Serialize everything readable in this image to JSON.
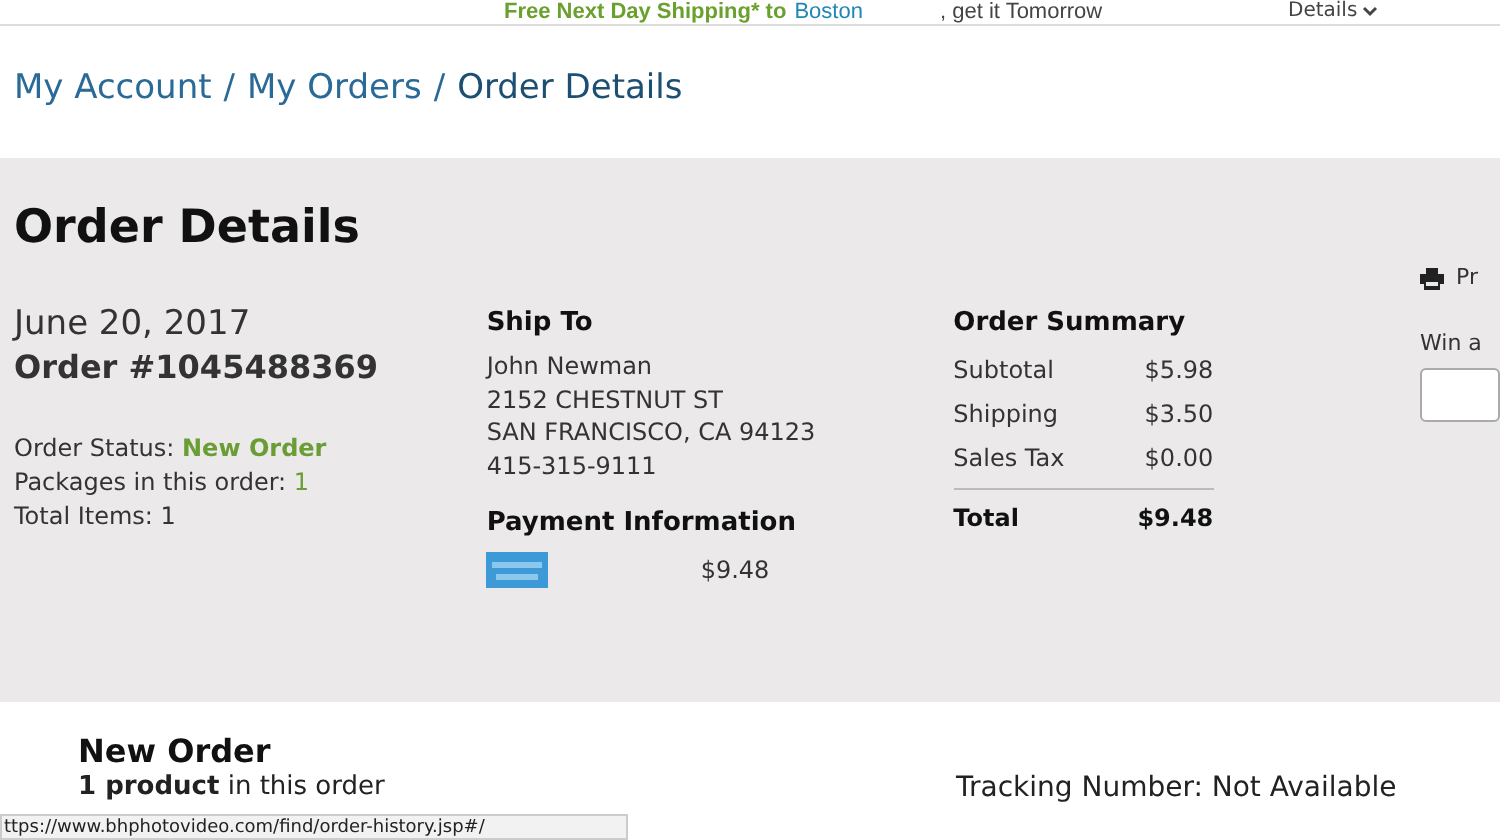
{
  "promo_bar": {
    "offer": "Free Next Day Shipping* to",
    "city": "Boston",
    "suffix": ", get it Tomorrow",
    "details": "Details"
  },
  "breadcrumb": [
    {
      "label": "My Account",
      "current": false
    },
    {
      "label": "My Orders",
      "current": false
    },
    {
      "label": "Order Details",
      "current": true
    }
  ],
  "separator": "/",
  "page_title": "Order Details",
  "order": {
    "date": "June 20, 2017",
    "number": "Order #1045488369",
    "status_label": "Order Status:",
    "status": "New Order",
    "packages_label": "Packages in this order:",
    "packages": "1",
    "items_label": "Total Items:",
    "items": "1"
  },
  "ship_to": {
    "heading": "Ship To",
    "lines": [
      "John Newman",
      "2152 CHESTNUT ST",
      "SAN FRANCISCO, CA 94123",
      "415-315-9111"
    ]
  },
  "payment": {
    "heading": "Payment Information",
    "amount": "$9.48"
  },
  "summary": {
    "heading": "Order Summary",
    "rows": [
      {
        "label": "Subtotal",
        "value": "$5.98"
      },
      {
        "label": "Shipping",
        "value": "$3.50"
      },
      {
        "label": "Sales Tax",
        "value": "$0.00"
      }
    ],
    "total": {
      "label": "Total",
      "value": "$9.48"
    }
  },
  "side": {
    "print": "Pr",
    "win": "Win a"
  },
  "package": {
    "title": "New Order",
    "count": "**1 product** in this order",
    "tracking": "Tracking Number: Not Available"
  },
  "status_url": "ttps://www.bhphotovideo.com/find/order-history.jsp#/"
}
